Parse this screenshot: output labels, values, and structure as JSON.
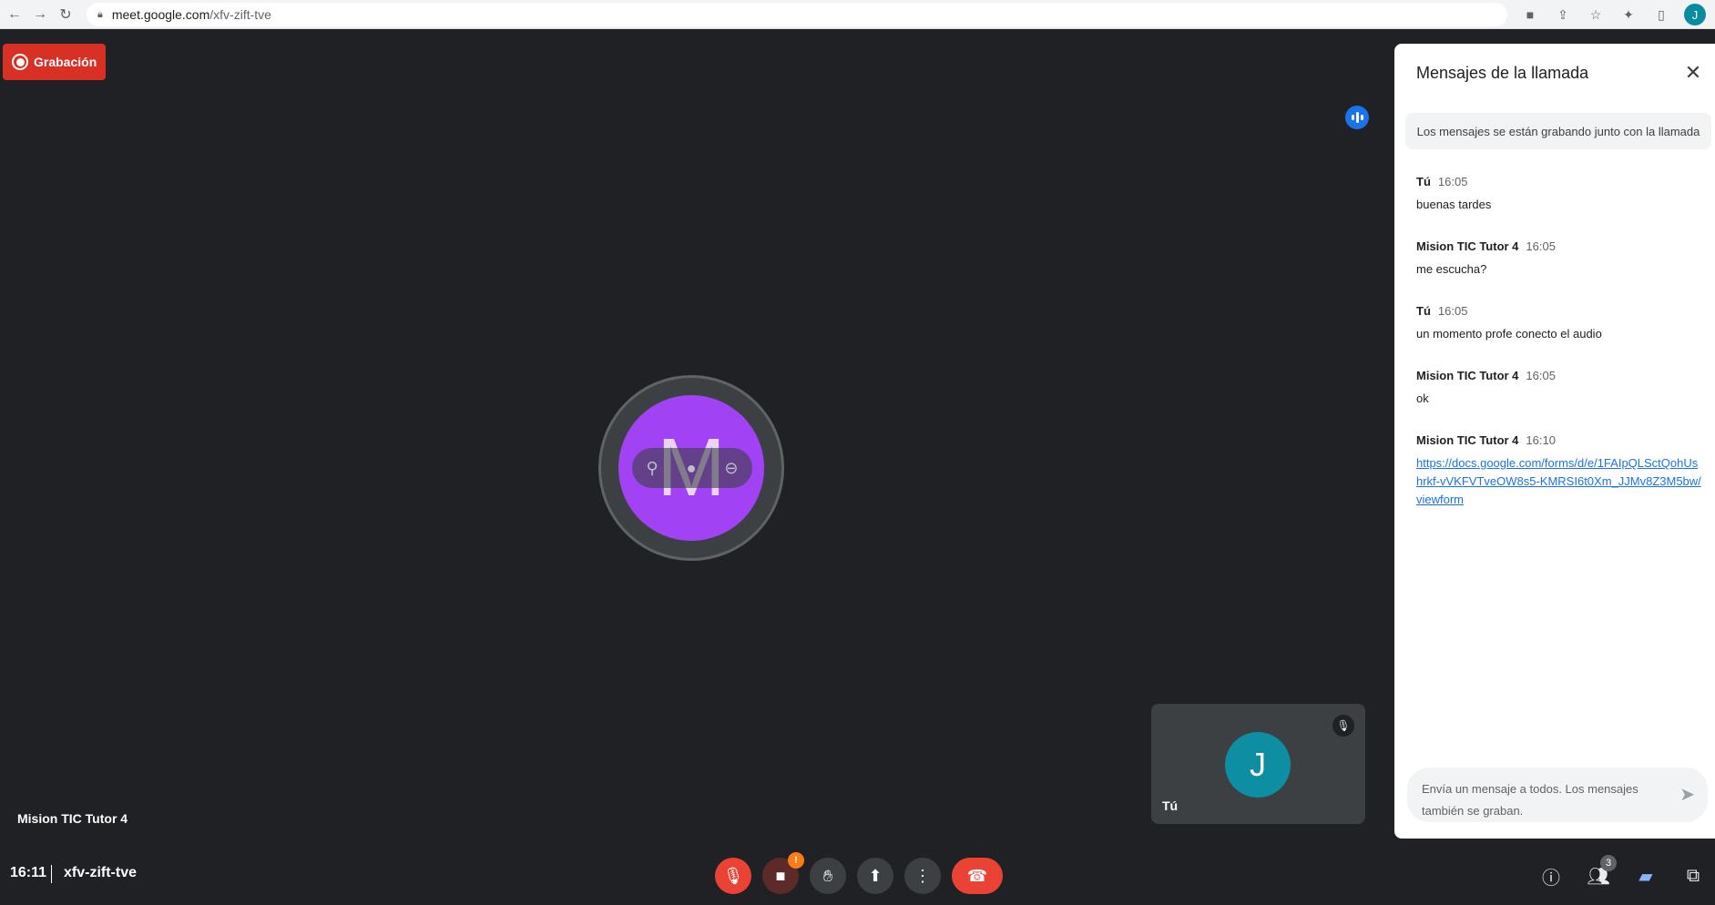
{
  "browser": {
    "url_host": "meet.google.com",
    "url_path": "/xfv-zift-tve",
    "profile_initial": "J"
  },
  "recording": {
    "label": "Grabación"
  },
  "main_tile": {
    "avatar_letter": "M",
    "avatar_color": "#a142f4",
    "participant_name": "Mision TIC Tutor 4"
  },
  "self_tile": {
    "avatar_letter": "J",
    "label": "Tú"
  },
  "chat": {
    "title": "Mensajes de la llamada",
    "recording_note": "Los mensajes se están grabando junto con la llamada",
    "messages": [
      {
        "sender": "Tú",
        "time": "16:05",
        "text": "buenas tardes",
        "is_link": false
      },
      {
        "sender": "Mision TIC Tutor 4",
        "time": "16:05",
        "text": "me escucha?",
        "is_link": false
      },
      {
        "sender": "Tú",
        "time": "16:05",
        "text": "un momento profe conecto el audio",
        "is_link": false
      },
      {
        "sender": "Mision TIC Tutor 4",
        "time": "16:05",
        "text": "ok",
        "is_link": false
      },
      {
        "sender": "Mision TIC Tutor 4",
        "time": "16:10",
        "text": "https://docs.google.com/forms/d/e/1FAIpQLSctQohUshrkf-vVKFVTveOW8s5-KMRSI6t0Xm_JJMv8Z3M5bw/viewform",
        "is_link": true
      }
    ],
    "input_placeholder": "Envía un mensaje a todos. Los mensajes también se graban."
  },
  "bottom_bar": {
    "time": "16:11",
    "meeting_code": "xfv-zift-tve",
    "camera_warning_badge": "!",
    "people_count": "3"
  },
  "colors": {
    "background": "#202124",
    "recording": "#d93025",
    "hangup": "#ea4335",
    "accent": "#1a73e8"
  }
}
